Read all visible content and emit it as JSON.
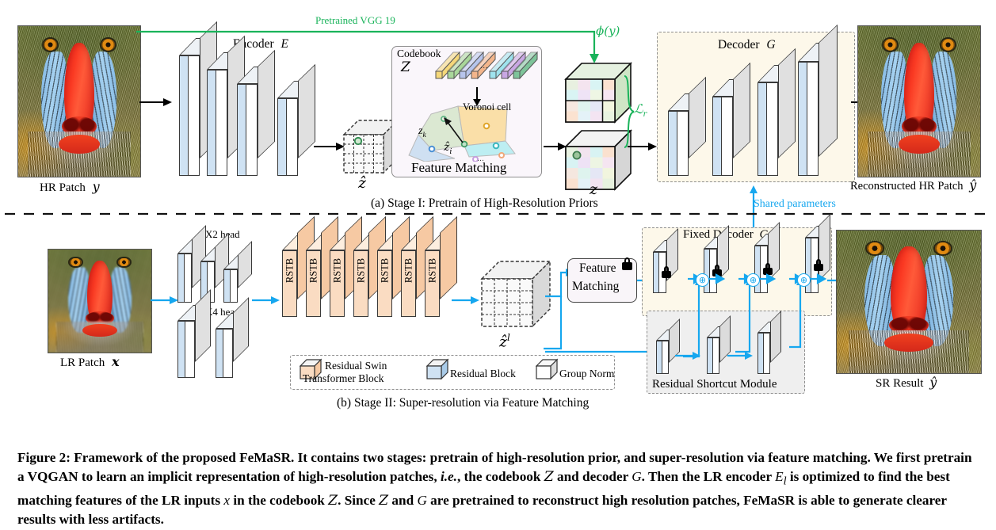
{
  "figure": {
    "caption_label": "Figure 2:",
    "caption_text": " Framework of the proposed FeMaSR. It contains two stages: pretrain of high-resolution prior, and super-resolution via feature matching. We first pretrain a VQGAN to learn an implicit representation of high-resolution patches, ",
    "caption_ie": "i.e.",
    "caption_text2": ", the codebook ",
    "caption_Z1": "Z",
    "caption_text3": " and decoder ",
    "caption_G1": "G",
    "caption_text4": ". Then the LR encoder ",
    "caption_El": "E",
    "caption_El_sub": "l",
    "caption_text5": " is optimized to find the best matching features of the LR inputs ",
    "caption_x": "x",
    "caption_text6": " in the codebook ",
    "caption_Z2": "Z",
    "caption_text7": ". Since ",
    "caption_Z3": "Z",
    "caption_text8": " and ",
    "caption_G2": "G",
    "caption_text9": " are pretrained to reconstruct high resolution patches, FeMaSR is able to generate clearer results with less artifacts."
  },
  "stage1": {
    "title": "(a) Stage I: Pretrain of High-Resolution Priors",
    "hr_patch_label": "HR Patch",
    "hr_patch_symbol": "y",
    "encoder_label": "Encoder",
    "encoder_symbol": "E",
    "vgg_label": "Pretrained VGG 19",
    "phi_label": "ϕ(y)",
    "loss_label": "ℒ",
    "loss_sub": "r",
    "zhat_label": "ẑ",
    "z_label": "z",
    "codebook_label": "Codebook",
    "codebook_symbol": "Z",
    "voronoi_label": "Voronoi cell",
    "feature_matching_label": "Feature Matching",
    "zk_label": "z",
    "zk_sub": "k",
    "zihat_label": "ẑ",
    "zihat_sub": "i",
    "ellipsis": "...",
    "decoder_label": "Decoder",
    "decoder_symbol": "G",
    "recon_label": "Reconstructed HR Patch",
    "recon_symbol": "ŷ",
    "shared_params_label": "Shared parameters",
    "encoder_blocks": 4,
    "decoder_blocks": 4,
    "codebook_colors": [
      "#f5d87a",
      "#a9d79a",
      "#b7c5ec",
      "#f3b58b",
      "#9fe3ee",
      "#c9a7e3",
      "#7ec49a"
    ],
    "voronoi_dot_colors": [
      "#4a8fd4",
      "#e0a52a",
      "#39b7bd",
      "#f0a87a",
      "#c59fe0",
      "#5ab27f"
    ]
  },
  "stage2": {
    "title": "(b) Stage II: Super-resolution via Feature Matching",
    "lr_patch_label": "LR Patch",
    "lr_patch_symbol": "x",
    "head_x2_label": "X2 head",
    "head_x4_label": "X4 head",
    "rstb_label": "RSTB",
    "rstb_count": 7,
    "zhat_l_label": "ẑ",
    "zhat_l_sup": "l",
    "feature_matching_line1": "Feature",
    "feature_matching_line2": "Matching",
    "fixed_decoder_label": "Fixed Decoder",
    "fixed_decoder_symbol": "G",
    "fixed_decoder_blocks": 4,
    "residual_shortcut_label": "Residual Shortcut Module",
    "shortcut_blocks": 3,
    "plus_symbol": "⊕",
    "sr_result_label": "SR Result",
    "sr_result_symbol": "ŷ",
    "x2_head_blocks": 3,
    "x4_head_blocks": 2
  },
  "legend": {
    "items": [
      {
        "label_line1": "Residual Swin",
        "label_line2": "Transformer Block",
        "color": "#fadcc2"
      },
      {
        "label_line1": "Residual Block",
        "label_line2": "",
        "color": "#cfe2f3"
      },
      {
        "label_line1": "Group Norm",
        "label_line2": "",
        "color": "#ffffff"
      }
    ]
  },
  "colors": {
    "accent_blue": "#16a7ef",
    "accent_green": "#19b35a",
    "rstb_fill": "#fadcc2",
    "resblock_fill": "#cfe2f3",
    "groupnorm_fill": "#ffffff",
    "slab_side": "#e0e0e0",
    "decoder_bg": "#fdf8ea",
    "codebook_bg": "#faf6fb",
    "shortcut_bg": "#efefef"
  }
}
